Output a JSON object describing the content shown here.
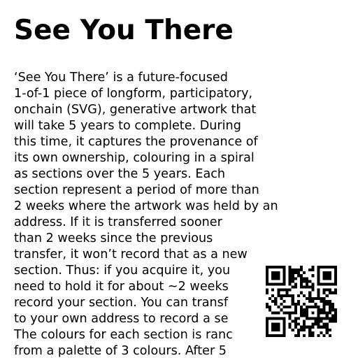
{
  "document": {
    "title": "See You There",
    "lines": [
      "‘See You There’ is a future-focused",
      "1-of-1 piece of longform, participatory,",
      "onchain (SVG), generative artwork that",
      "will take 5 years to complete. During",
      "this time, it captures the provenance of",
      "its own ownership, colouring in a spiral",
      "as sections over the 5 years. Each",
      "section represent a period of more than",
      "2 weeks where the artwork was held by an",
      "address. If it is transferred sooner",
      "than 2 weeks since the previous",
      "transfer, it won’t record that as a new",
      "section. Thus: if you acquire it, you",
      "need to hold it for about ~2 weeks",
      "record your section. You can transf",
      "to your own address to record a se",
      "The colours for each section is ranc",
      "from a palette of 3 colours. After 5"
    ]
  },
  "qr_code": {
    "icon": "qr-code-icon",
    "fg": "#000000",
    "bg": "#ffffff",
    "modules": 25
  }
}
